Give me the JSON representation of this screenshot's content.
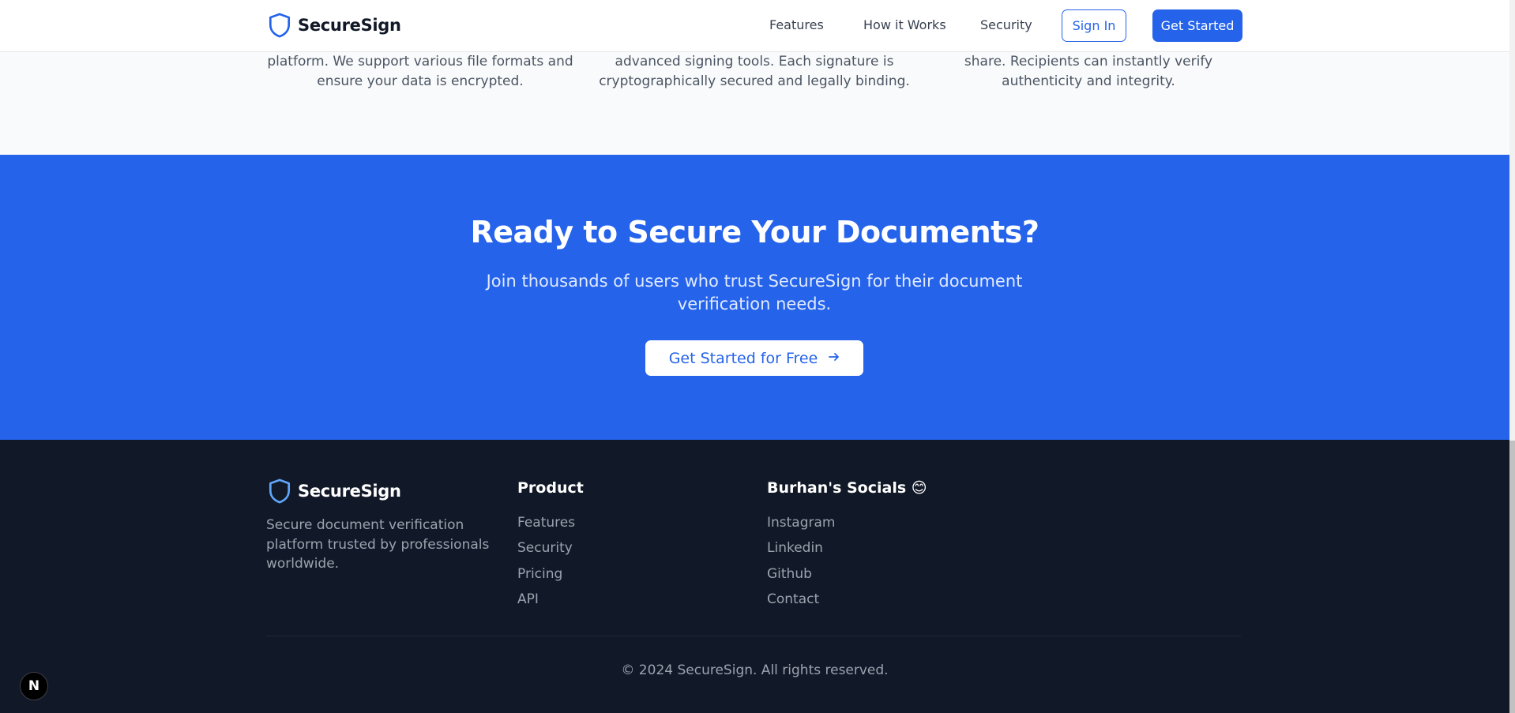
{
  "header": {
    "brand": "SecureSign",
    "nav": [
      "Features",
      "How it Works",
      "Security"
    ],
    "sign_in": "Sign In",
    "get_started": "Get Started"
  },
  "features_tail": [
    "platform. We support various file formats and\nensure your data is encrypted.",
    "advanced signing tools. Each signature is\ncryptographically secured and legally binding.",
    "share. Recipients can instantly verify\nauthenticity and integrity."
  ],
  "cta": {
    "title": "Ready to Secure Your Documents?",
    "subtitle": "Join thousands of users who trust SecureSign for their document verification needs.",
    "button": "Get Started for Free",
    "button_icon": "arrow-right-icon"
  },
  "footer": {
    "brand": "SecureSign",
    "description": "Secure document verification platform trusted by professionals worldwide.",
    "product_title": "Product",
    "product_links": [
      "Features",
      "Security",
      "Pricing",
      "API"
    ],
    "socials_title": "Burhan's Socials 😊",
    "socials_links": [
      "Instagram",
      "Linkedin",
      "Github",
      "Contact"
    ],
    "copyright": "© 2024 SecureSign. All rights reserved."
  },
  "devtools_badge": "N",
  "colors": {
    "primary": "#2563eb",
    "footer_bg": "#111827",
    "page_bg": "#f9fafb"
  }
}
